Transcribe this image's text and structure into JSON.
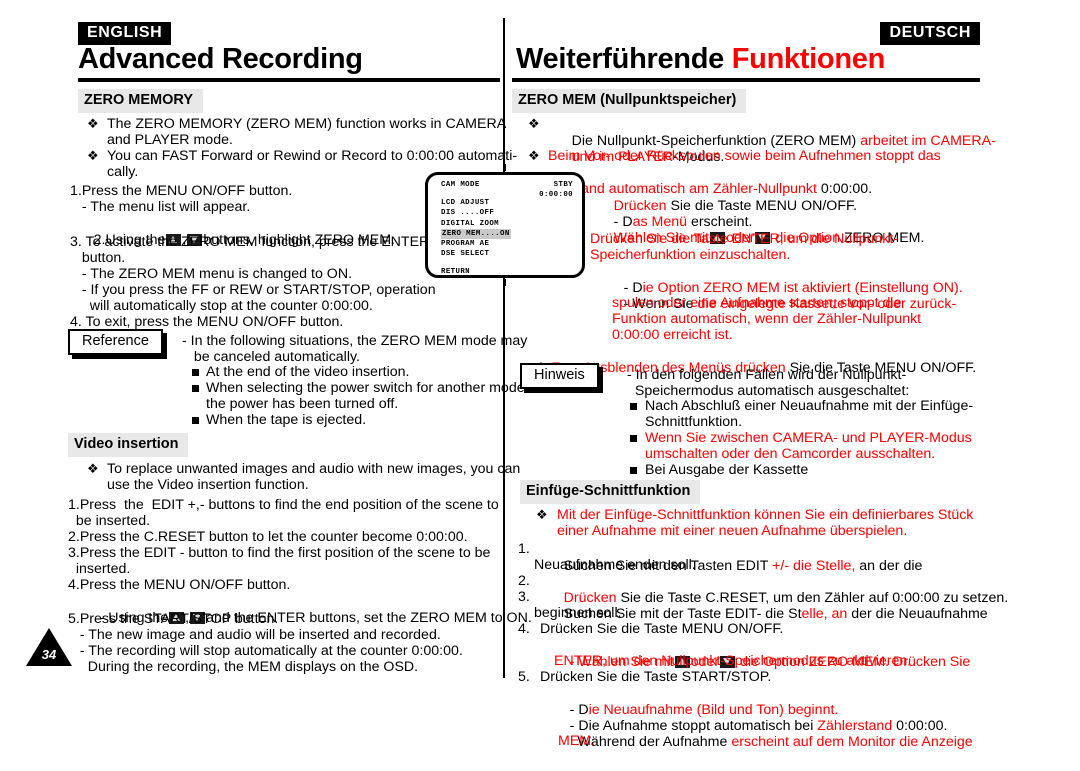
{
  "page": {
    "number": "34",
    "accent_red": "#ff0000",
    "heading_bg": "#e8e8e8"
  },
  "english": {
    "lang_badge": "ENGLISH",
    "chapter_title": "Advanced Recording",
    "section1_heading": "ZERO MEMORY",
    "section1_bullets": [
      "The ZERO MEMORY (ZERO MEM) function works in CAMERA",
      "and PLAYER mode.",
      "You can FAST Forward or Rewind or Record to 0:00:00 automati-",
      "cally."
    ],
    "section1_steps": [
      "1.Press the MENU ON/OFF button.",
      "   - The menu list will appear.",
      "2.Using the",
      "buttons, highlight ZERO MEM.",
      "3. To activate the ZERO MEM function, press the ENTER",
      "   button.",
      "   - The ZERO MEM menu is changed to ON.",
      "   - If you press the FF or REW or START/STOP, operation",
      "     will automatically stop at the counter 0:00:00.",
      "4. To exit, press the MENU ON/OFF button."
    ],
    "reference_label": "Reference",
    "reference_lines": [
      "- In the following situations, the ZERO MEM mode may",
      "   be canceled automatically."
    ],
    "reference_items": [
      "At the end of the video insertion.",
      "When selecting the power switch for another mode or",
      "the power has been turned off.",
      "When the tape is ejected."
    ],
    "section2_heading": "Video insertion",
    "section2_bullets": [
      "To replace unwanted images and audio with new images, you can",
      "use the Video insertion function."
    ],
    "section2_steps": [
      "1.Press  the  EDIT +,- buttons to find the end position of the scene to",
      "  be inserted.",
      "2.Press the C.RESET button to let the counter become 0:00:00.",
      "3.Press the EDIT - button to find the first position of the scene to be",
      "  inserted.",
      "4.Press the MENU ON/OFF button.",
      "  - Using the",
      "and the ENTER buttons, set the ZERO MEM to ON.",
      "5.Press the START/STOP button.",
      "   - The new image and audio will be inserted and recorded.",
      "   - The recording will stop automatically at the counter 0:00:00.",
      "     During the recording, the MEM displays on the OSD."
    ]
  },
  "german": {
    "lang_badge": "DEUTSCH",
    "chapter_title_black": "Weiterführende ",
    "chapter_title_red": "Funktionen",
    "section1_heading": "ZERO MEM (Nullpunktspeicher)",
    "section1_bullet1_black": "Die Nullpunkt-Speicherfunktion (ZERO MEM) ",
    "section1_bullet1_red": "arbeitet im CAMERA-",
    "section1_bullet1_line2_red": "und im PLAYER",
    "section1_bullet1_line2_black": "-Modus.",
    "section1_bullet2_line1": "Beim Vor- oder Rückspulen sowie beim Aufnehmen stoppt das",
    "section1_bullet2_line2_red": "Band automatisch am Zähler-Nullpunkt ",
    "section1_bullet2_line2_black": "0:00:00.",
    "step1_red": "Drücken",
    "step1_black": " Sie die Taste MENU ON/OFF.",
    "step1_sub_black": "- D",
    "step1_sub_red": "as Menü",
    "step1_sub_black2": " erscheint.",
    "step2_red": "Wählen Sie mit",
    "step2_mid_red": "oder",
    "step2_tail_red": " die Option",
    "step2_tail_black": " ZERO MEM.",
    "step3_line1_red": "Drücken Sie die Taste ENTER, um die Nullpunkt-",
    "step3_line2_red": "Speicherfunktion einzuschalten.",
    "step3_sub1_black": "- D",
    "step3_sub1_red": "ie Option ZERO MEM ist aktiviert (Einstellung ON).",
    "step3_sub2_black": "- Wenn Sie ",
    "step3_sub2_red": "die eingelegte Kassette vor- oder zurück-",
    "step3_sub2_line2_red": "spulen oder eine Aufnahme starten, stoppt die",
    "step3_sub2_line3_red": "Funktion automatisch, wenn der Zähler-Nullpunkt",
    "step3_sub2_line4_red": "0:00:00 erreicht ist.",
    "step4_num": "4.",
    "step4_red": " Zum Ausblenden des Menüs drücken",
    "step4_black": " Sie die Taste MENU ON/OFF.",
    "hinweis_label": "Hinweis",
    "hinweis_lines": [
      "- In den folgenden Fällen wird der Nullpunkt-",
      "  Speichermodus automatisch ausgeschaltet:"
    ],
    "hinweis_items": [
      {
        "text": "Nach Abschluß einer Neuaufnahme mit der Einfüge-",
        "color": "black"
      },
      {
        "text": "Schnittfunktion.",
        "color": "black"
      },
      {
        "text": "Wenn Sie zwischen CAMERA- und PLAYER-Modus",
        "color": "red"
      },
      {
        "text": "umschalten oder den Camcorder ausschalten.",
        "color": "red"
      },
      {
        "text": "Bei Ausgabe der Kassette",
        "color": "black"
      }
    ],
    "section2_heading": "Einfüge-Schnittfunktion",
    "section2_bullet_line1_red": "Mit der Einfüge-Schnittfunktion können Sie ein definierbares Stück",
    "section2_bullet_line2_red": "einer Aufnahme mit einer neuen Aufnahme überspielen.",
    "g_step1_black": "Suchen Sie mit den Tasten EDIT ",
    "g_step1_red": "+/- die Stelle,",
    "g_step1_black2": " an der die",
    "g_step1_line2_black": "Neuaufnahme enden soll.",
    "g_step2_red": "Drücken",
    "g_step2_black": " Sie die Taste C.RESET, um den Zähler auf 0:00:00 zu setzen.",
    "g_step3_black": "Suchen Sie mit der Taste EDIT- die St",
    "g_step3_red": "elle, an",
    "g_step3_black2": " der die Neuaufnahme",
    "g_step3_line2_black": "beginnen soll.",
    "g_step4_black": "Drücken Sie die Taste MENU ON/OFF.",
    "g_step4_sub_red": "- Wählen Sie mit",
    "g_step4_sub_mid_red": "oder",
    "g_step4_sub_tail_red": " die Option ZERO MEM. Drücken Sie",
    "g_step4_sub_line2_red": "ENTER, um den Nullpunkt-Speichermodus zu aktivieren.",
    "g_step5_black": "Drücken Sie die Taste START/STOP.",
    "g_step5_sub1_black": "- D",
    "g_step5_sub1_red": "ie Neuaufnahme (Bild und Ton) beginnt.",
    "g_step5_sub2_black": "- Die Aufnahme stoppt automatisch bei ",
    "g_step5_sub2_red": "Zählerstand",
    "g_step5_sub2_black2": " 0:00:00.",
    "g_step5_sub3_black": "  Während der Aufnahme ",
    "g_step5_sub3_red": "erscheint auf dem Monitor die Anzeige",
    "g_step5_sub4_red": "MEM."
  },
  "osd": {
    "title": "CAM MODE",
    "corner_line1": "STBY",
    "corner_line2": "0:00:00",
    "items": [
      "LCD ADJUST",
      "DIS ....OFF",
      "DIGITAL ZOOM",
      "ZERO MEM....ON",
      "PROGRAM AE",
      "DSE SELECT"
    ],
    "highlighted_index": 3,
    "return_label": "RETURN"
  }
}
